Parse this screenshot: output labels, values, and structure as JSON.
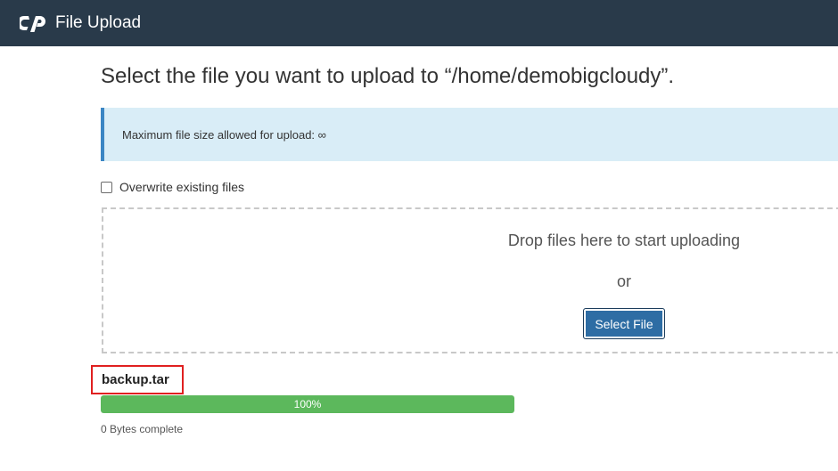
{
  "header": {
    "app_title": "File Upload",
    "logo_icon": "cpanel-logo-icon"
  },
  "main": {
    "heading": "Select the file you want to upload to “/home/demobigcloudy”.",
    "alert_text": "Maximum file size allowed for upload: ∞",
    "overwrite_label": "Overwrite existing files",
    "overwrite_checked": false,
    "dropzone": {
      "prompt": "Drop files here to start uploading",
      "or_text": "or",
      "select_button": "Select File"
    }
  },
  "upload": {
    "filename": "backup.tar",
    "progress_label": "100%",
    "progress_percent": 100,
    "status": "0 Bytes complete"
  },
  "colors": {
    "topbar": "#293a4a",
    "alert_bg": "#d9edf7",
    "alert_border": "#3b86c4",
    "button": "#2e6da4",
    "progress": "#5cb85c",
    "highlight_box": "#e02020"
  }
}
